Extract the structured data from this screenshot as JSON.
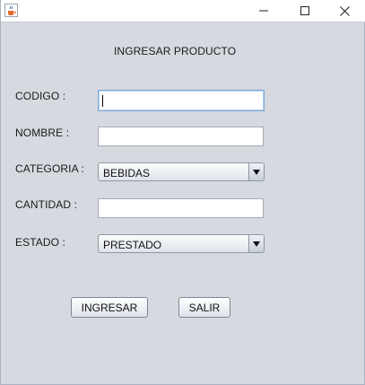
{
  "titlebar": {
    "app_icon": "java-cup-icon",
    "minimize_icon": "minimize-icon",
    "maximize_icon": "maximize-icon",
    "close_icon": "close-icon"
  },
  "form": {
    "heading": "INGRESAR PRODUCTO",
    "codigo_label": "CODIGO :",
    "codigo_value": "",
    "nombre_label": "NOMBRE :",
    "nombre_value": "",
    "categoria_label": "CATEGORIA :",
    "categoria_selected": "BEBIDAS",
    "cantidad_label": "CANTIDAD :",
    "cantidad_value": "",
    "estado_label": "ESTADO  :",
    "estado_selected": "PRESTADO"
  },
  "buttons": {
    "ingresar": "INGRESAR",
    "salir": "SALIR"
  },
  "colors": {
    "background": "#d6d9df",
    "titlebar": "#ffffff",
    "focus_border": "#7ea9d6"
  }
}
